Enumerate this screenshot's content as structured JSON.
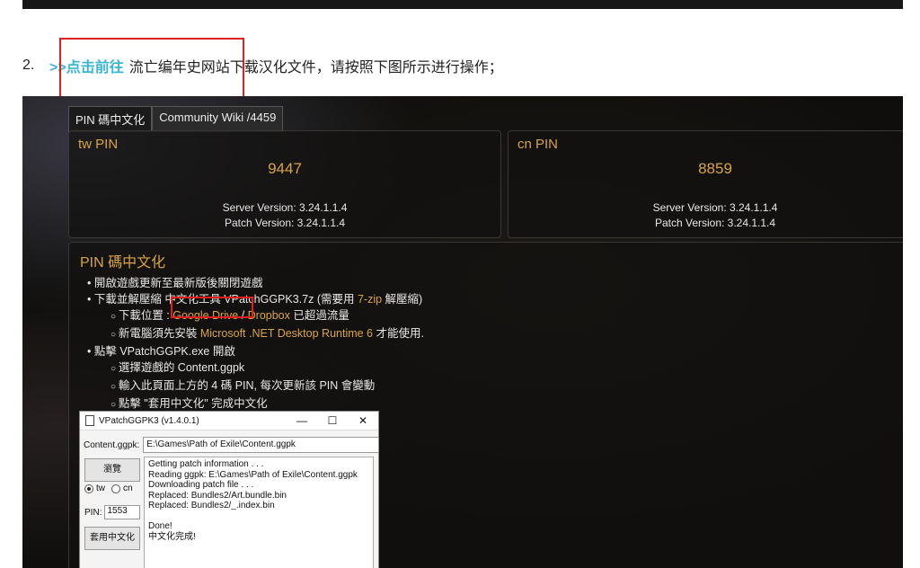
{
  "step": {
    "number": "2.",
    "link_text": ">>点击前往",
    "text": " 流亡编年史网站下载汉化文件，请按照下图所示进行操作；"
  },
  "tabs": [
    {
      "label": "PIN 碼中文化"
    },
    {
      "label": "Community Wiki /4459"
    }
  ],
  "pins": {
    "tw": {
      "label": "tw PIN",
      "value": "9447",
      "server": "Server Version: 3.24.1.1.4",
      "patch": "Patch Version: 3.24.1.1.4"
    },
    "cn": {
      "label": "cn PIN",
      "value": "8859",
      "server": "Server Version: 3.24.1.1.4",
      "patch": "Patch Version: 3.24.1.1.4"
    }
  },
  "guide": {
    "title": "PIN 碼中文化",
    "item1": "開啟遊戲更新至最新版後關閉遊戲",
    "item2_pre": "下載並解壓縮 中文化工具 VPatchGGPK3.7z (需要用 ",
    "item2_link": "7-zip",
    "item2_post": " 解壓縮)",
    "sub_download_pre": "下載位置 : ",
    "sub_download_gd": "Google Drive",
    "sub_download_sep": " / ",
    "sub_download_db": "Dropbox",
    "sub_download_post": " 已超過流量",
    "sub_runtime_pre": "新電腦須先安裝 ",
    "sub_runtime_link": "Microsoft .NET Desktop Runtime 6",
    "sub_runtime_post": " 才能使用.",
    "item3": "點擊 VPatchGGPK.exe 開啟",
    "sub3a": "選擇遊戲的 Content.ggpk",
    "sub3b": "輸入此頁面上方的 4 碼 PIN, 每次更新該 PIN 會變動",
    "sub3c": "點擊 \"套用中文化\" 完成中文化"
  },
  "app": {
    "title": "VPatchGGPK3 (v1.4.0.1)",
    "minimize": "—",
    "maximize": "☐",
    "close": "✕",
    "content_label": "Content.ggpk:",
    "content_value": "E:\\Games\\Path of Exile\\Content.ggpk",
    "browse_label": "瀏覽",
    "radio_tw": "tw",
    "radio_cn": "cn",
    "pin_label": "PIN:",
    "pin_value": "1553",
    "apply_label": "套用中文化",
    "log": [
      "Getting patch information . . .",
      "Reading ggpk: E:\\Games\\Path of Exile\\Content.ggpk",
      "Downloading patch file . . .",
      "Replaced: Bundles2/Art.bundle.bin",
      "Replaced: Bundles2/_.index.bin",
      "",
      "Done!",
      "中文化完成!"
    ]
  }
}
